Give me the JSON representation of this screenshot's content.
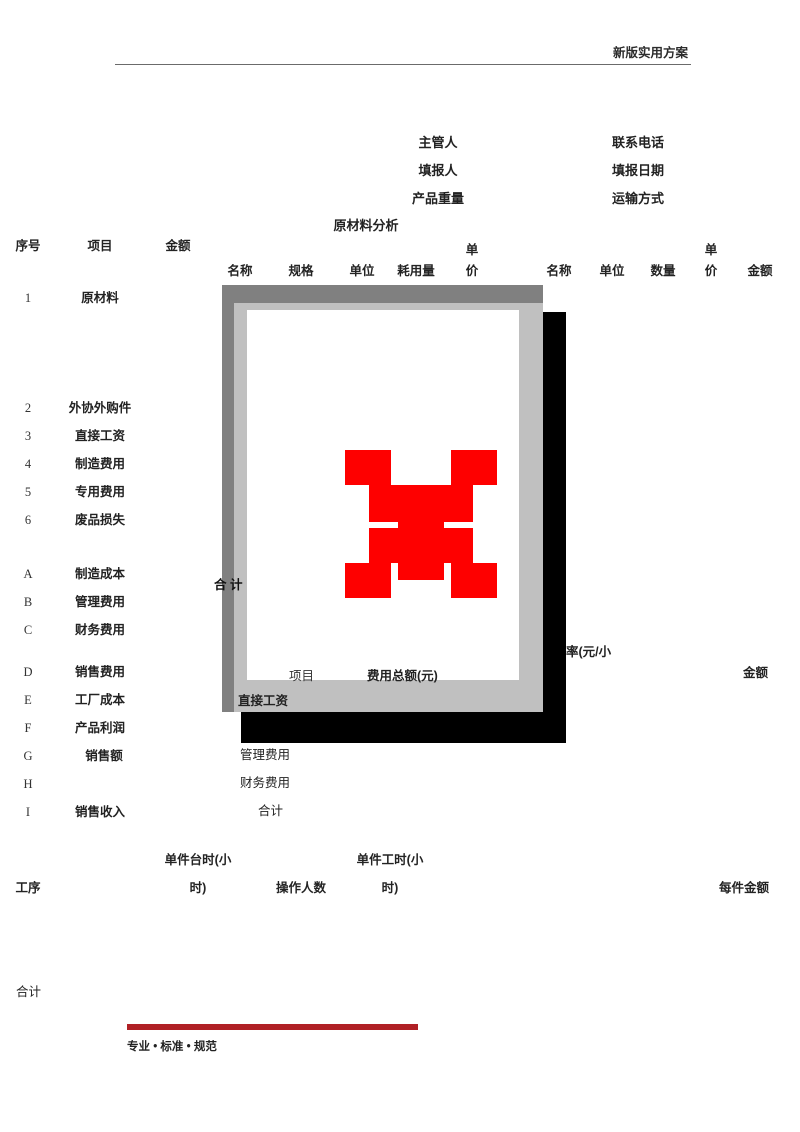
{
  "header": {
    "title": "新版实用方案"
  },
  "meta": {
    "left": [
      {
        "label": "主管人"
      },
      {
        "label": "填报人"
      },
      {
        "label": "产品重量"
      }
    ],
    "right": [
      {
        "label": "联系电话"
      },
      {
        "label": "填报日期"
      },
      {
        "label": "运输方式"
      }
    ]
  },
  "section_title": "原材料分析",
  "main_table": {
    "left_headers": [
      "序号",
      "项目",
      "金额"
    ],
    "material_group_title": "原材料分析",
    "material_headers": [
      "名称",
      "规格",
      "单位",
      "耗用量",
      "单价"
    ],
    "purchase_headers": [
      "名称",
      "单位",
      "数量",
      "单价",
      "金额"
    ],
    "unit_price_wrap": "单",
    "unit_price_wrap2": "价",
    "rows": [
      {
        "no": "1",
        "label": "原材料"
      },
      {
        "no": "2",
        "label": "外协外购件"
      },
      {
        "no": "3",
        "label": "直接工资"
      },
      {
        "no": "4",
        "label": "制造费用"
      },
      {
        "no": "5",
        "label": "专用费用"
      },
      {
        "no": "6",
        "label": "废品损失"
      },
      {
        "no": "A",
        "label": "制造成本"
      },
      {
        "no": "B",
        "label": "管理费用"
      },
      {
        "no": "C",
        "label": "财务费用"
      },
      {
        "no": "D",
        "label": "销售费用"
      },
      {
        "no": "E",
        "label": "工厂成本"
      },
      {
        "no": "F",
        "label": "产品利润"
      },
      {
        "no": "G",
        "label": "销售额"
      },
      {
        "no": "H",
        "label": ""
      },
      {
        "no": "I",
        "label": "销售收入"
      }
    ]
  },
  "expense_table": {
    "total_label": "合 计",
    "headers": [
      "项目",
      "费用总额(元)"
    ],
    "rows": [
      {
        "label": "直接工资"
      },
      {
        "label": "管理费用"
      },
      {
        "label": "财务费用"
      },
      {
        "label": "合计"
      }
    ],
    "rate_fragment": "率(元/小",
    "amount_label": "金额"
  },
  "process_table": {
    "headers": [
      "工序",
      "单件台时(小",
      "时)",
      "操作人数",
      "单件工时(小",
      "时)",
      "每件金额"
    ],
    "total_label": "合计"
  },
  "placeholder": {
    "icon": "broken-image-red-x",
    "frame_color": "#808080",
    "band_color": "#c0c0c0",
    "shadow_color": "#000000",
    "x_color": "#fe0000"
  },
  "footer": {
    "bar_color": "#b02025",
    "text": "专业 • 标准 • 规范"
  }
}
